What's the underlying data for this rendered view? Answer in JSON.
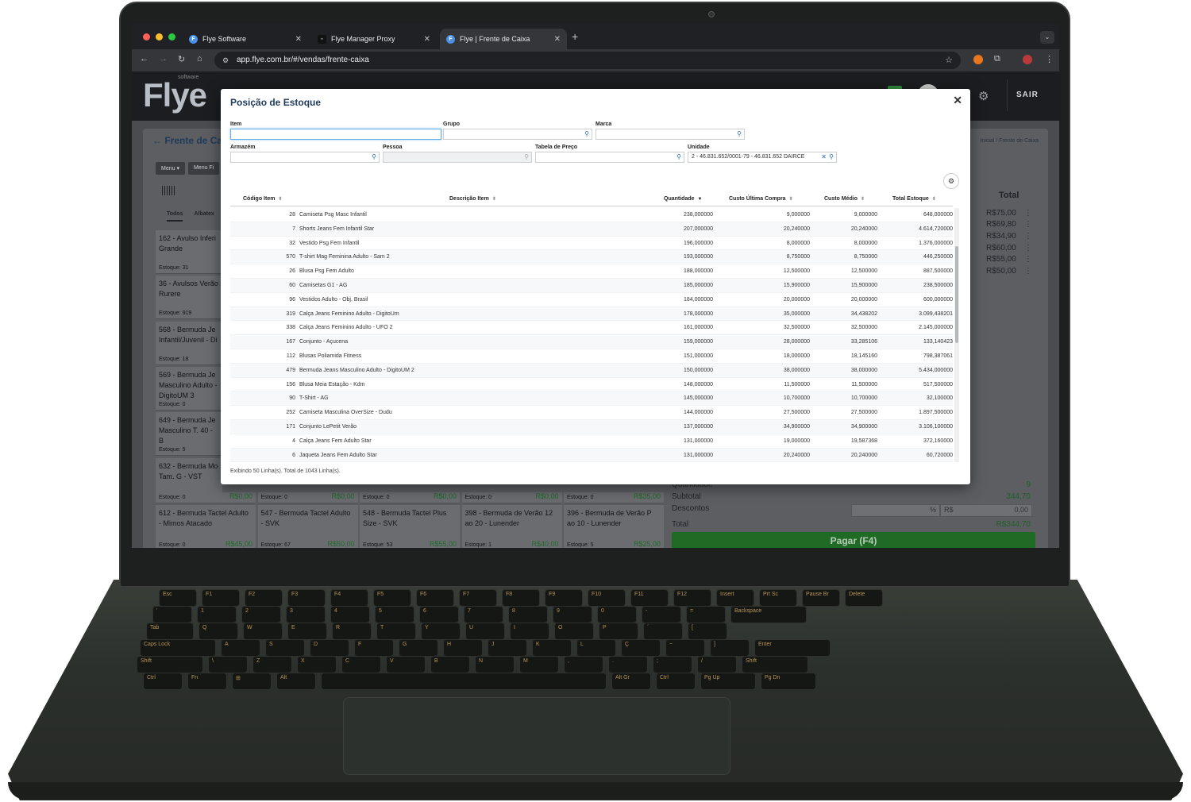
{
  "browser": {
    "tabs": [
      {
        "title": "Flye Software"
      },
      {
        "title": "Flye Manager Proxy"
      },
      {
        "title": "Flye | Frente de Caixa"
      }
    ],
    "url": "app.flye.com.br/#/vendas/frente-caixa"
  },
  "app": {
    "logo": "Flye",
    "logo_sub": "software",
    "logout": "SAIR",
    "page_title": "Frente de Ca",
    "breadcrumb": {
      "home": "Inicial",
      "sep": "/",
      "current": "Frente de Caixa"
    },
    "menu_buttons": [
      "Menu ▾",
      "Menu Fi"
    ],
    "subtabs": [
      "Todos",
      "Albatex"
    ],
    "products_left": [
      {
        "name": "162 - Avulso Inferi Grande",
        "stock": "Estoque: 31"
      },
      {
        "name": "36 - Avulsos Verão Rurere",
        "stock": "Estoque: 919"
      },
      {
        "name": "568 - Bermuda Je Infantil/Juvenil - Di",
        "stock": "Estoque: 18"
      },
      {
        "name": "569 - Bermuda Je Masculino Adulto - DigitoUM 3",
        "stock": "Estoque: 0"
      },
      {
        "name": "649 - Bermuda Je Masculino T. 40 - B",
        "stock": "Estoque: 5"
      },
      {
        "name": "632 - Bermuda Mo Tam. G - VST",
        "stock": "Estoque: 0"
      }
    ],
    "stock_row": [
      {
        "stock": "Estoque: 0",
        "price": "R$0,00"
      },
      {
        "stock": "Estoque: 0",
        "price": "R$0,00"
      },
      {
        "stock": "Estoque: 0",
        "price": "R$0,00"
      },
      {
        "stock": "Estoque: 0",
        "price": "R$0,00"
      },
      {
        "stock": "Estoque: 0",
        "price": "R$35,00"
      }
    ],
    "products_bottom": [
      {
        "name": "612 - Bermuda Tactel Adulto - Mimos Atacado",
        "stock": "Estoque: 0",
        "price": "R$45,00"
      },
      {
        "name": "547 - Bermuda Tactel Adulto - SVK",
        "stock": "Estoque: 67",
        "price": "R$50,00"
      },
      {
        "name": "548 - Bermuda Tactel Plus Size - SVK",
        "stock": "Estoque: 53",
        "price": "R$55,00"
      },
      {
        "name": "398 - Bermuda de Verão 12 ao 20 - Lunender",
        "stock": "Estoque: 1",
        "price": "R$40,00"
      },
      {
        "name": "396 - Bermuda de Verão P ao 10 - Lunender",
        "stock": "Estoque: 5",
        "price": "R$25,00"
      }
    ],
    "cart": {
      "total_header": "Total",
      "prices": [
        "R$75,00",
        "R$69,80",
        "R$34,90",
        "R$60,00",
        "R$55,00",
        "R$50,00"
      ]
    },
    "summary": {
      "qty_label": "Quantidade",
      "qty": "9",
      "subtotal_label": "Subtotal",
      "subtotal": "344,70",
      "discounts_label": "Descontos",
      "discount_pct_symbol": "%",
      "discount_currency_symbol": "R$",
      "discount_value": "0,00",
      "total_label": "Total",
      "total": "R$344,70",
      "pay_button": "Pagar (F4)"
    }
  },
  "modal": {
    "title": "Posição de Estoque",
    "filters": {
      "item": {
        "label": "Item",
        "value": ""
      },
      "grupo": {
        "label": "Grupo",
        "value": ""
      },
      "marca": {
        "label": "Marca",
        "value": ""
      },
      "armazem": {
        "label": "Armazém",
        "value": ""
      },
      "pessoa": {
        "label": "Pessoa",
        "value": ""
      },
      "tabela": {
        "label": "Tabela de Preço",
        "value": ""
      },
      "unidade": {
        "label": "Unidade",
        "value": "2 - 46.831.652/0001-79 - 46.831.652 DAIRCE"
      }
    },
    "columns": [
      "Código Item",
      "Descrição Item",
      "Quantidade",
      "Custo Última Compra",
      "Custo Médio",
      "Total Estoque"
    ],
    "rows": [
      [
        "28",
        "Camiseta Psg Masc Infantil",
        "238,000000",
        "9,000000",
        "9,000000",
        "648,000000"
      ],
      [
        "7",
        "Shorts Jeans Fem Infantil Star",
        "207,000000",
        "20,240000",
        "20,240000",
        "4.614,720000"
      ],
      [
        "32",
        "Vestido Psg Fem Infantil",
        "196,000000",
        "8,000000",
        "8,000000",
        "1.376,000000"
      ],
      [
        "570",
        "T-shirt Mag Feminina Adulto - Sam 2",
        "193,000000",
        "8,750000",
        "8,750000",
        "446,250000"
      ],
      [
        "26",
        "Blusa Psg Fem Adulto",
        "188,000000",
        "12,500000",
        "12,500000",
        "887,500000"
      ],
      [
        "60",
        "Camisetas G1 - AG",
        "185,000000",
        "15,900000",
        "15,900000",
        "238,500000"
      ],
      [
        "96",
        "Vestidos Adulto - Obj. Brasil",
        "184,000000",
        "20,000000",
        "20,000000",
        "600,000000"
      ],
      [
        "319",
        "Calça Jeans Feminino Adulto - DigitoUm",
        "178,000000",
        "35,000000",
        "34,438202",
        "3.099,438201"
      ],
      [
        "338",
        "Calça Jeans Feminino Adulto - UFO 2",
        "161,000000",
        "32,500000",
        "32,500000",
        "2.145,000000"
      ],
      [
        "167",
        "Conjunto - Açucena",
        "159,000000",
        "28,000000",
        "33,285106",
        "133,140423"
      ],
      [
        "112",
        "Blusas Poliamida Fitness",
        "151,000000",
        "18,000000",
        "18,145160",
        "798,387061"
      ],
      [
        "479",
        "Bermuda Jeans Masculino Adulto - DigitoUM 2",
        "150,000000",
        "38,000000",
        "38,000000",
        "5.434,000000"
      ],
      [
        "156",
        "Blusa Meia Estação - Kdm",
        "148,000000",
        "11,500000",
        "11,500000",
        "517,500000"
      ],
      [
        "90",
        "T-Shirt - AG",
        "145,000000",
        "10,700000",
        "10,700000",
        "32,100000"
      ],
      [
        "252",
        "Camiseta Masculina OverSize - Dudu",
        "144,000000",
        "27,500000",
        "27,500000",
        "1.897,500000"
      ],
      [
        "171",
        "Conjunto LePetit Verão",
        "137,000000",
        "34,900000",
        "34,900000",
        "3.106,100000"
      ],
      [
        "4",
        "Calça Jeans Fem Adulto Star",
        "131,000000",
        "19,000000",
        "19,587368",
        "372,160000"
      ],
      [
        "6",
        "Jaqueta Jeans Fem Adulto Star",
        "131,000000",
        "20,240000",
        "20,240000",
        "60,720000"
      ]
    ],
    "footer": "Exibindo 50 Linha(s). Total de 1043 Linha(s)."
  },
  "keyboard": {
    "row1": [
      "Esc",
      "F1",
      "F2",
      "F3",
      "F4",
      "F5",
      "F6",
      "F7",
      "F8",
      "F9",
      "F10",
      "F11",
      "F12",
      "Insert",
      "Prt Sc",
      "Pause Br",
      "Delete"
    ],
    "row2": [
      "'",
      "1",
      "2",
      "3",
      "4",
      "5",
      "6",
      "7",
      "8",
      "9",
      "0",
      "-",
      "=",
      "Backspace"
    ],
    "row3": [
      "Tab",
      "Q",
      "W",
      "E",
      "R",
      "T",
      "Y",
      "U",
      "I",
      "O",
      "P",
      "´",
      "["
    ],
    "row4": [
      "Caps Lock",
      "A",
      "S",
      "D",
      "F",
      "G",
      "H",
      "J",
      "K",
      "L",
      "Ç",
      "~",
      "]",
      "Enter"
    ],
    "row5": [
      "Shift",
      "\\",
      "Z",
      "X",
      "C",
      "V",
      "B",
      "N",
      "M",
      ",",
      ".",
      ";",
      "/",
      "Shift"
    ],
    "row6": [
      "Ctrl",
      "Fn",
      "⊞",
      "Alt",
      "",
      "Alt Gr",
      "Ctrl",
      "Pg Up",
      "Pg Dn"
    ]
  },
  "colors": {
    "accent_blue": "#2b6cb0",
    "pay_green": "#1f6b26",
    "title_navy": "#1f3a5a"
  }
}
